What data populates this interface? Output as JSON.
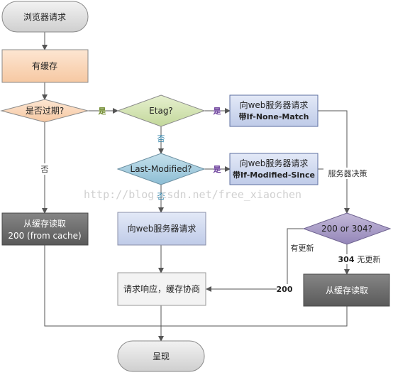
{
  "nodes": {
    "start": "浏览器请求",
    "has_cache": "有缓存",
    "expired": "是否过期?",
    "etag": "Etag?",
    "req_none_match_1": "向web服务器请求",
    "req_none_match_2": "带If-None-Match",
    "last_modified": "Last-Modified?",
    "req_mod_since_1": "向web服务器请求",
    "req_mod_since_2": "带If-Modified-Since",
    "read_cache_1": "从缓存读取",
    "read_cache_2": "200 (from cache)",
    "req_server": "向web服务器请求",
    "status_check": "200 or 304?",
    "response": "请求响应，缓存协商",
    "read_cache_304": "从缓存读取",
    "end": "呈现"
  },
  "edges": {
    "yes_1": "是",
    "yes_2": "是",
    "yes_3": "是",
    "no_1": "否",
    "no_2": "否",
    "no_3": "否",
    "server_decides": "服务器决策",
    "updated": "有更新",
    "code_304": "304",
    "not_updated": "无更新",
    "code_200": "200"
  },
  "watermark": "http://blog.csdn.net/free_xiaochen",
  "colors": {
    "orange_fill": "#f9d9bf",
    "green_fill": "#d6e5b6",
    "blue_fill": "#cfd8ee",
    "teal_fill": "#a8cfe0",
    "purple_fill": "#aea2c8",
    "dark_fill": "#6d6d6d",
    "gray_fill": "#e6e6e6"
  }
}
